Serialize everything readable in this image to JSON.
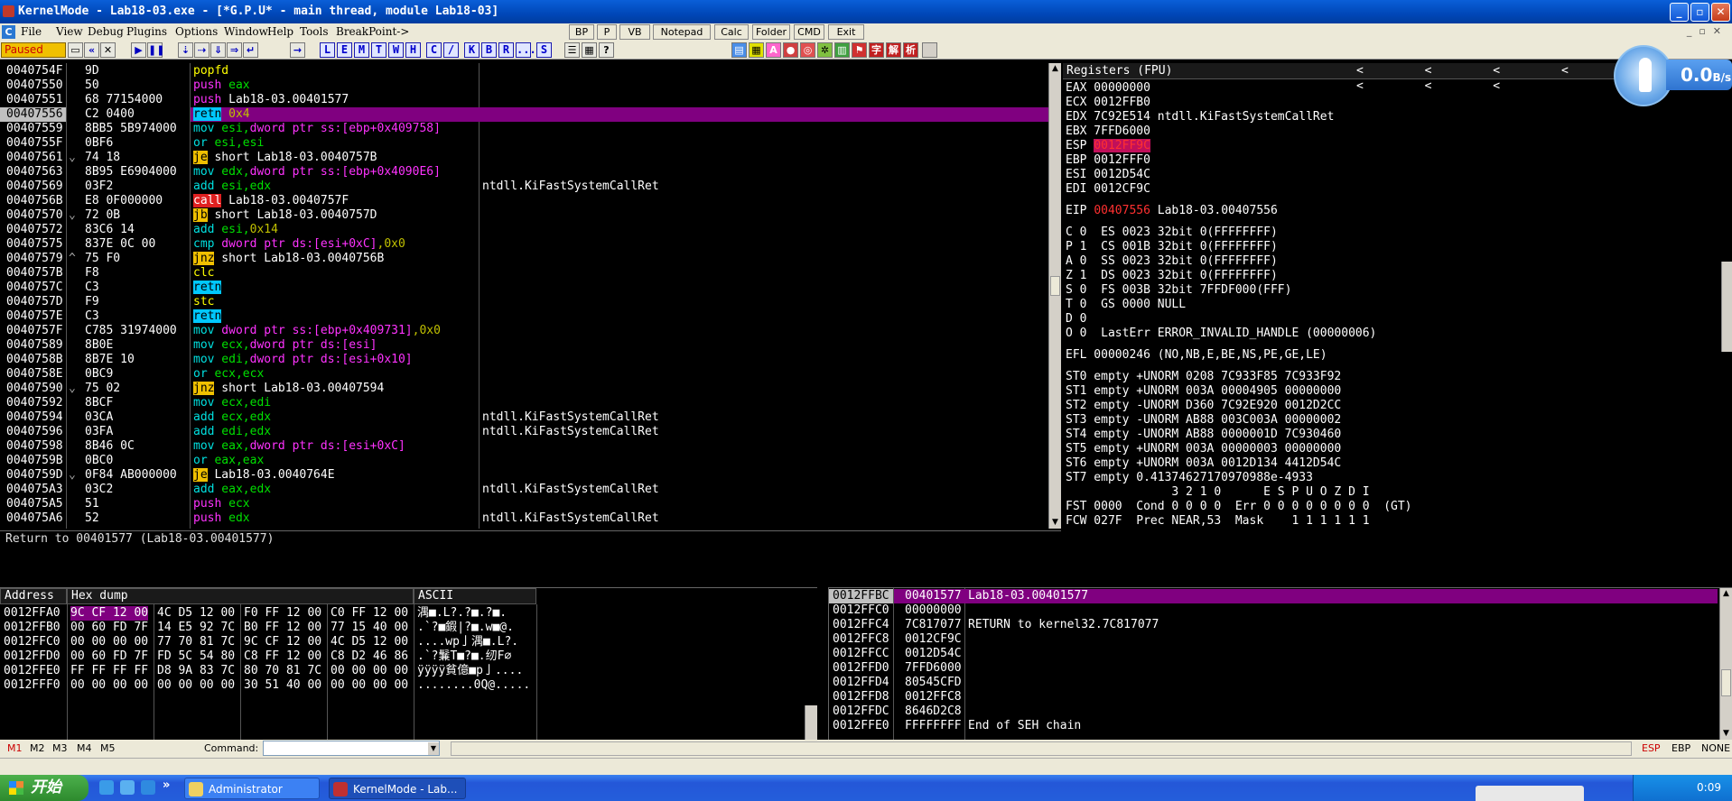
{
  "window": {
    "title": "KernelMode - Lab18-03.exe - [*G.P.U* - main thread, module Lab18-03]"
  },
  "menu": {
    "items": [
      "File",
      "View",
      "Debug",
      "Plugins",
      "Options",
      "Window",
      "Help",
      "Tools",
      "BreakPoint->"
    ],
    "buttons": [
      "BP",
      "P",
      "VB",
      "Notepad",
      "Calc",
      "Folder",
      "CMD",
      "Exit"
    ]
  },
  "toolbar": {
    "status": "Paused",
    "letters": [
      "L",
      "E",
      "M",
      "T",
      "W",
      "H",
      "C",
      "/",
      "K",
      "B",
      "R",
      "...",
      "S"
    ]
  },
  "disasm": {
    "rows": [
      {
        "addr": "0040754F",
        "jmp": "",
        "hex": "9D",
        "cmd": [
          {
            "t": "popfd",
            "c": "kw-yel"
          }
        ],
        "cmt": ""
      },
      {
        "addr": "00407550",
        "jmp": "",
        "hex": "50",
        "cmd": [
          {
            "t": "push",
            "c": "kw-mag"
          },
          {
            "t": " eax",
            "c": "op-grn"
          }
        ],
        "cmt": ""
      },
      {
        "addr": "00407551",
        "jmp": "",
        "hex": "68 77154000",
        "cmd": [
          {
            "t": "push",
            "c": "kw-mag"
          },
          {
            "t": " Lab18-03.00401577",
            "c": ""
          }
        ],
        "cmt": ""
      },
      {
        "addr": "00407556",
        "jmp": "",
        "hex": "C2 0400",
        "cmd": [
          {
            "t": "retn",
            "c": "blk-cyan"
          },
          {
            "t": " 0x4",
            "c": "op-yel"
          }
        ],
        "cmt": "",
        "selected": true
      },
      {
        "addr": "00407559",
        "jmp": "",
        "hex": "8BB5 5B974000",
        "cmd": [
          {
            "t": "mov",
            "c": "kw-cyan"
          },
          {
            "t": " esi,",
            "c": "op-grn"
          },
          {
            "t": "dword ptr ss:[ebp+0x409758]",
            "c": "kw-mag"
          }
        ],
        "cmt": ""
      },
      {
        "addr": "0040755F",
        "jmp": "",
        "hex": "0BF6",
        "cmd": [
          {
            "t": "or",
            "c": "kw-cyan"
          },
          {
            "t": " esi,esi",
            "c": "op-grn"
          }
        ],
        "cmt": ""
      },
      {
        "addr": "00407561",
        "jmp": "⌄",
        "hex": "74 18",
        "cmd": [
          {
            "t": "je",
            "c": "blk-yel"
          },
          {
            "t": " short Lab18-03.0040757B",
            "c": ""
          }
        ],
        "cmt": ""
      },
      {
        "addr": "00407563",
        "jmp": "",
        "hex": "8B95 E6904000",
        "cmd": [
          {
            "t": "mov",
            "c": "kw-cyan"
          },
          {
            "t": " edx,",
            "c": "op-grn"
          },
          {
            "t": "dword ptr ss:[ebp+0x4090E6]",
            "c": "kw-mag"
          }
        ],
        "cmt": ""
      },
      {
        "addr": "00407569",
        "jmp": "",
        "hex": "03F2",
        "cmd": [
          {
            "t": "add",
            "c": "kw-cyan"
          },
          {
            "t": " esi,edx",
            "c": "op-grn"
          }
        ],
        "cmt": "ntdll.KiFastSystemCallRet"
      },
      {
        "addr": "0040756B",
        "jmp": "",
        "hex": "E8 0F000000",
        "cmd": [
          {
            "t": "call",
            "c": "blk-red"
          },
          {
            "t": " Lab18-03.0040757F",
            "c": ""
          }
        ],
        "cmt": ""
      },
      {
        "addr": "00407570",
        "jmp": "⌄",
        "hex": "72 0B",
        "cmd": [
          {
            "t": "jb",
            "c": "blk-yel"
          },
          {
            "t": " short Lab18-03.0040757D",
            "c": ""
          }
        ],
        "cmt": ""
      },
      {
        "addr": "00407572",
        "jmp": "",
        "hex": "83C6 14",
        "cmd": [
          {
            "t": "add",
            "c": "kw-cyan"
          },
          {
            "t": " esi,",
            "c": "op-grn"
          },
          {
            "t": "0x14",
            "c": "op-yel"
          }
        ],
        "cmt": ""
      },
      {
        "addr": "00407575",
        "jmp": "",
        "hex": "837E 0C 00",
        "cmd": [
          {
            "t": "cmp",
            "c": "kw-cyan"
          },
          {
            "t": " dword ptr ds:[esi+0xC]",
            "c": "kw-mag"
          },
          {
            "t": ",0x0",
            "c": "op-yel"
          }
        ],
        "cmt": ""
      },
      {
        "addr": "00407579",
        "jmp": "^",
        "hex": "75 F0",
        "cmd": [
          {
            "t": "jnz",
            "c": "blk-yel"
          },
          {
            "t": " short Lab18-03.0040756B",
            "c": ""
          }
        ],
        "cmt": ""
      },
      {
        "addr": "0040757B",
        "jmp": "",
        "hex": "F8",
        "cmd": [
          {
            "t": "clc",
            "c": "kw-yel"
          }
        ],
        "cmt": ""
      },
      {
        "addr": "0040757C",
        "jmp": "",
        "hex": "C3",
        "cmd": [
          {
            "t": "retn",
            "c": "blk-cyan"
          }
        ],
        "cmt": ""
      },
      {
        "addr": "0040757D",
        "jmp": "",
        "hex": "F9",
        "cmd": [
          {
            "t": "stc",
            "c": "kw-yel"
          }
        ],
        "cmt": ""
      },
      {
        "addr": "0040757E",
        "jmp": "",
        "hex": "C3",
        "cmd": [
          {
            "t": "retn",
            "c": "blk-cyan"
          }
        ],
        "cmt": ""
      },
      {
        "addr": "0040757F",
        "jmp": "",
        "hex": "C785 31974000",
        "cmd": [
          {
            "t": "mov",
            "c": "kw-cyan"
          },
          {
            "t": " dword ptr ss:[ebp+0x409731]",
            "c": "kw-mag"
          },
          {
            "t": ",0x0",
            "c": "op-yel"
          }
        ],
        "cmt": ""
      },
      {
        "addr": "00407589",
        "jmp": "",
        "hex": "8B0E",
        "cmd": [
          {
            "t": "mov",
            "c": "kw-cyan"
          },
          {
            "t": " ecx,",
            "c": "op-grn"
          },
          {
            "t": "dword ptr ds:[esi]",
            "c": "kw-mag"
          }
        ],
        "cmt": ""
      },
      {
        "addr": "0040758B",
        "jmp": "",
        "hex": "8B7E 10",
        "cmd": [
          {
            "t": "mov",
            "c": "kw-cyan"
          },
          {
            "t": " edi,",
            "c": "op-grn"
          },
          {
            "t": "dword ptr ds:[esi+0x10]",
            "c": "kw-mag"
          }
        ],
        "cmt": ""
      },
      {
        "addr": "0040758E",
        "jmp": "",
        "hex": "0BC9",
        "cmd": [
          {
            "t": "or",
            "c": "kw-cyan"
          },
          {
            "t": " ecx,ecx",
            "c": "op-grn"
          }
        ],
        "cmt": ""
      },
      {
        "addr": "00407590",
        "jmp": "⌄",
        "hex": "75 02",
        "cmd": [
          {
            "t": "jnz",
            "c": "blk-yel"
          },
          {
            "t": " short Lab18-03.00407594",
            "c": ""
          }
        ],
        "cmt": ""
      },
      {
        "addr": "00407592",
        "jmp": "",
        "hex": "8BCF",
        "cmd": [
          {
            "t": "mov",
            "c": "kw-cyan"
          },
          {
            "t": " ecx,edi",
            "c": "op-grn"
          }
        ],
        "cmt": ""
      },
      {
        "addr": "00407594",
        "jmp": "",
        "hex": "03CA",
        "cmd": [
          {
            "t": "add",
            "c": "kw-cyan"
          },
          {
            "t": " ecx,edx",
            "c": "op-grn"
          }
        ],
        "cmt": "ntdll.KiFastSystemCallRet"
      },
      {
        "addr": "00407596",
        "jmp": "",
        "hex": "03FA",
        "cmd": [
          {
            "t": "add",
            "c": "kw-cyan"
          },
          {
            "t": " edi,edx",
            "c": "op-grn"
          }
        ],
        "cmt": "ntdll.KiFastSystemCallRet"
      },
      {
        "addr": "00407598",
        "jmp": "",
        "hex": "8B46 0C",
        "cmd": [
          {
            "t": "mov",
            "c": "kw-cyan"
          },
          {
            "t": " eax,",
            "c": "op-grn"
          },
          {
            "t": "dword ptr ds:[esi+0xC]",
            "c": "kw-mag"
          }
        ],
        "cmt": ""
      },
      {
        "addr": "0040759B",
        "jmp": "",
        "hex": "0BC0",
        "cmd": [
          {
            "t": "or",
            "c": "kw-cyan"
          },
          {
            "t": " eax,eax",
            "c": "op-grn"
          }
        ],
        "cmt": ""
      },
      {
        "addr": "0040759D",
        "jmp": "⌄",
        "hex": "0F84 AB000000",
        "cmd": [
          {
            "t": "je",
            "c": "blk-yel"
          },
          {
            "t": " Lab18-03.0040764E",
            "c": ""
          }
        ],
        "cmt": ""
      },
      {
        "addr": "004075A3",
        "jmp": "",
        "hex": "03C2",
        "cmd": [
          {
            "t": "add",
            "c": "kw-cyan"
          },
          {
            "t": " eax,edx",
            "c": "op-grn"
          }
        ],
        "cmt": "ntdll.KiFastSystemCallRet"
      },
      {
        "addr": "004075A5",
        "jmp": "",
        "hex": "51",
        "cmd": [
          {
            "t": "push",
            "c": "kw-mag"
          },
          {
            "t": " ecx",
            "c": "op-grn"
          }
        ],
        "cmt": ""
      },
      {
        "addr": "004075A6",
        "jmp": "",
        "hex": "52",
        "cmd": [
          {
            "t": "push",
            "c": "kw-mag"
          },
          {
            "t": " edx",
            "c": "op-grn"
          }
        ],
        "cmt": "ntdll.KiFastSystemCallRet"
      }
    ],
    "info": "Return to 00401577 (Lab18-03.00401577)"
  },
  "registers": {
    "header": "Registers (FPU)",
    "arrows": "< < < < < < < <",
    "lines": [
      {
        "t": "EAX 00000000"
      },
      {
        "t": "ECX 0012FFB0"
      },
      {
        "t": "EDX 7C92E514 ntdll.KiFastSystemCallRet"
      },
      {
        "t": "EBX 7FFD6000"
      },
      {
        "t": "ESP ",
        "hl": "0012FF9C"
      },
      {
        "t": "EBP 0012FFF0"
      },
      {
        "t": "ESI 0012D54C"
      },
      {
        "t": "EDI 0012CF9C"
      },
      {
        "t": ""
      },
      {
        "t": "EIP ",
        "red": "00407556",
        "rest": " Lab18-03.00407556"
      },
      {
        "t": ""
      },
      {
        "t": "C 0  ES 0023 32bit 0(FFFFFFFF)"
      },
      {
        "t": "P 1  CS 001B 32bit 0(FFFFFFFF)"
      },
      {
        "t": "A 0  SS 0023 32bit 0(FFFFFFFF)"
      },
      {
        "t": "Z 1  DS 0023 32bit 0(FFFFFFFF)"
      },
      {
        "t": "S 0  FS 003B 32bit 7FFDF000(FFF)"
      },
      {
        "t": "T 0  GS 0000 NULL"
      },
      {
        "t": "D 0"
      },
      {
        "t": "O 0  LastErr ERROR_INVALID_HANDLE (00000006)"
      },
      {
        "t": ""
      },
      {
        "t": "EFL 00000246 (NO,NB,E,BE,NS,PE,GE,LE)"
      },
      {
        "t": ""
      },
      {
        "t": "ST0 empty +UNORM 0208 7C933F85 7C933F92"
      },
      {
        "t": "ST1 empty +UNORM 003A 00004905 00000000"
      },
      {
        "t": "ST2 empty -UNORM D360 7C92E920 0012D2CC"
      },
      {
        "t": "ST3 empty -UNORM AB88 003C003A 00000002"
      },
      {
        "t": "ST4 empty -UNORM AB88 0000001D 7C930460"
      },
      {
        "t": "ST5 empty +UNORM 003A 00000003 00000000"
      },
      {
        "t": "ST6 empty +UNORM 003A 0012D134 4412D54C"
      },
      {
        "t": "ST7 empty 0.41374627170970988e-4933"
      },
      {
        "t": "               3 2 1 0      E S P U O Z D I"
      },
      {
        "t": "FST 0000  Cond 0 0 0 0  Err 0 0 0 0 0 0 0 0  (GT)"
      },
      {
        "t": "FCW 027F  Prec NEAR,53  Mask    1 1 1 1 1 1"
      }
    ]
  },
  "speed_widget": {
    "value": "0.0",
    "unit": "B/s"
  },
  "dump": {
    "headers": {
      "address": "Address",
      "hex": "Hex dump",
      "ascii": "ASCII"
    },
    "rows": [
      {
        "addr": "0012FFA0",
        "g1": "9C CF 12 00",
        "g2": "4C D5 12 00",
        "g3": "F0 FF 12 00",
        "g4": "C0 FF 12 00",
        "ascii": "湡■.L?.?■.?■."
      },
      {
        "addr": "0012FFB0",
        "g1": "00 60 FD 7F",
        "g2": "14 E5 92 7C",
        "g3": "B0 FF 12 00",
        "g4": "77 15 40 00",
        "ascii": ".`?■鍜|?■.w■@."
      },
      {
        "addr": "0012FFC0",
        "g1": "00 00 00 00",
        "g2": "77 70 81 7C",
        "g3": "9C CF 12 00",
        "g4": "4C D5 12 00",
        "ascii": "....wp亅湡■.L?."
      },
      {
        "addr": "0012FFD0",
        "g1": "00 60 FD 7F",
        "g2": "FD 5C 54 80",
        "g3": "C8 FF 12 00",
        "g4": "C8 D2 46 86",
        "ascii": ".`?鬑T■?■.纫F∅"
      },
      {
        "addr": "0012FFE0",
        "g1": "FF FF FF FF",
        "g2": "D8 9A 83 7C",
        "g3": "80 70 81 7C",
        "g4": "00 00 00 00",
        "ascii": "ÿÿÿÿ貧億■p亅...."
      },
      {
        "addr": "0012FFF0",
        "g1": "00 00 00 00",
        "g2": "00 00 00 00",
        "g3": "30 51 40 00",
        "g4": "00 00 00 00",
        "ascii": "........0Q@....."
      }
    ]
  },
  "stack": {
    "rows": [
      {
        "addr": "0012FFBC",
        "val": "00401577",
        "cmt": "Lab18-03.00401577",
        "selected": true
      },
      {
        "addr": "0012FFC0",
        "val": "00000000",
        "cmt": ""
      },
      {
        "addr": "0012FFC4",
        "val": "7C817077",
        "cmt": "RETURN to kernel32.7C817077"
      },
      {
        "addr": "0012FFC8",
        "val": "0012CF9C",
        "cmt": ""
      },
      {
        "addr": "0012FFCC",
        "val": "0012D54C",
        "cmt": ""
      },
      {
        "addr": "0012FFD0",
        "val": "7FFD6000",
        "cmt": ""
      },
      {
        "addr": "0012FFD4",
        "val": "80545CFD",
        "cmt": ""
      },
      {
        "addr": "0012FFD8",
        "val": "0012FFC8",
        "cmt": ""
      },
      {
        "addr": "0012FFDC",
        "val": "8646D2C8",
        "cmt": ""
      },
      {
        "addr": "0012FFE0",
        "val": "FFFFFFFF",
        "cmt": "End of SEH chain"
      }
    ]
  },
  "command_bar": {
    "memory_tabs": [
      "M1",
      "M2",
      "M3",
      "M4",
      "M5"
    ],
    "label": "Command:",
    "value": "",
    "right": [
      "ESP",
      "EBP",
      "NONE"
    ]
  },
  "taskbar": {
    "start": "开始",
    "tasks": [
      "Administrator",
      "KernelMode - Lab..."
    ],
    "clock": "0:09"
  }
}
